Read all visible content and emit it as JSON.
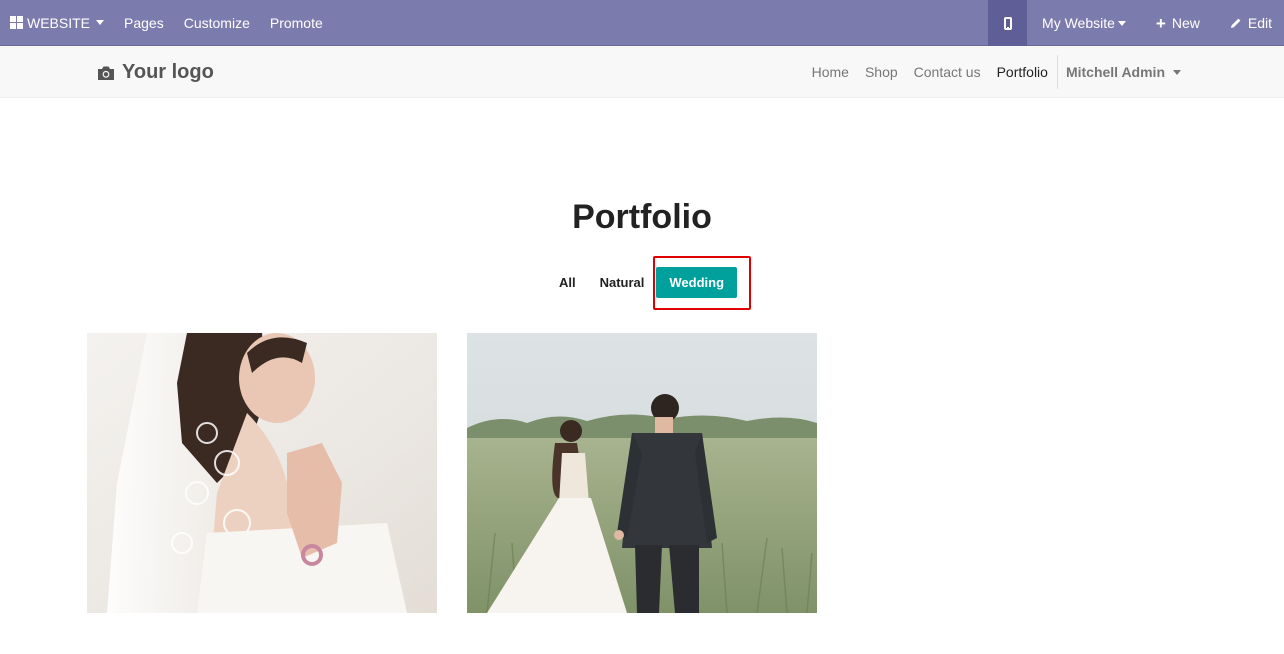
{
  "adminbar": {
    "app_menu_label": "WEBSITE",
    "pages_label": "Pages",
    "customize_label": "Customize",
    "promote_label": "Promote",
    "website_switcher_label": "My Website",
    "new_label": "New",
    "edit_label": "Edit"
  },
  "header": {
    "logo_text": "Your logo",
    "nav": {
      "home": "Home",
      "shop": "Shop",
      "contact": "Contact us",
      "portfolio": "Portfolio"
    },
    "user_name": "Mitchell Admin"
  },
  "main": {
    "title": "Portfolio",
    "filters": {
      "all": "All",
      "natural": "Natural",
      "wedding": "Wedding"
    },
    "active_filter": "Wedding"
  },
  "colors": {
    "admin_bar": "#7c7bad",
    "accent": "#00a09d",
    "highlight": "#e00000"
  }
}
